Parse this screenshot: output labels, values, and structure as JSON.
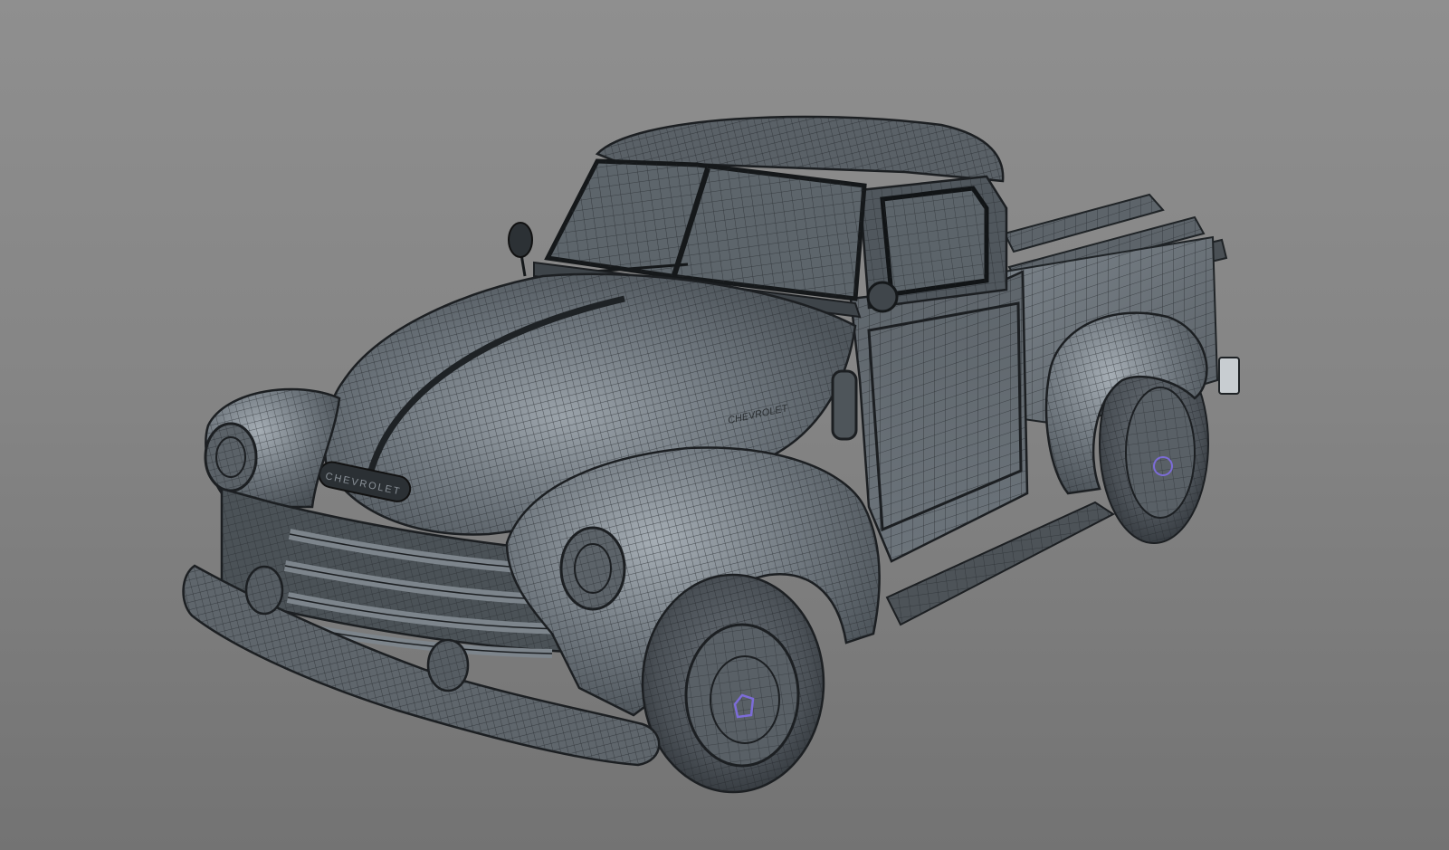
{
  "scene": {
    "background": "#858585",
    "subject": "wireframe-pickup-truck",
    "render_mode": "shaded-wireframe",
    "body_color": "#5f666c",
    "wire_color": "#23272a",
    "dark_color": "#2a2e31",
    "highlight_color": "#9aa3ab",
    "accent_color": "#7c6cd8"
  },
  "badges": {
    "hood_badge_text": "CHEVROLET",
    "fender_badge_text": "CHEVROLET"
  }
}
